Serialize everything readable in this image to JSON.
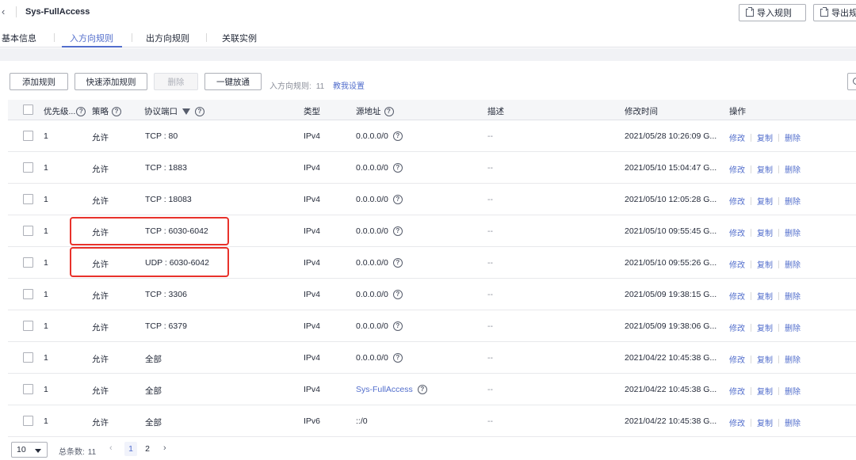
{
  "header": {
    "title": "Sys-FullAccess",
    "import_label": "导入规则",
    "export_label": "导出规"
  },
  "tabs": [
    {
      "label": "基本信息",
      "active": false
    },
    {
      "label": "入方向规则",
      "active": true
    },
    {
      "label": "出方向规则",
      "active": false
    },
    {
      "label": "关联实例",
      "active": false
    }
  ],
  "toolbar": {
    "add_rule": "添加规则",
    "quick_add": "快速添加规则",
    "delete": "删除",
    "one_click": "一键放通",
    "rule_count_label": "入方向规则:",
    "rule_count": "11",
    "help_link": "教我设置"
  },
  "table": {
    "columns": {
      "priority": "优先级...",
      "policy": "策略",
      "protocol_port": "协议端口",
      "type": "类型",
      "source": "源地址",
      "description": "描述",
      "modified": "修改时间",
      "actions": "操作"
    },
    "action_labels": {
      "edit": "修改",
      "copy": "复制",
      "delete": "删除"
    },
    "rows": [
      {
        "priority": "1",
        "policy": "允许",
        "protocol_port": "TCP : 80",
        "type": "IPv4",
        "source": "0.0.0.0/0",
        "source_is_link": false,
        "source_help": true,
        "description": "--",
        "modified": "2021/05/28 10:26:09 G..."
      },
      {
        "priority": "1",
        "policy": "允许",
        "protocol_port": "TCP : 1883",
        "type": "IPv4",
        "source": "0.0.0.0/0",
        "source_is_link": false,
        "source_help": true,
        "description": "--",
        "modified": "2021/05/10 15:04:47 G..."
      },
      {
        "priority": "1",
        "policy": "允许",
        "protocol_port": "TCP : 18083",
        "type": "IPv4",
        "source": "0.0.0.0/0",
        "source_is_link": false,
        "source_help": true,
        "description": "--",
        "modified": "2021/05/10 12:05:28 G..."
      },
      {
        "priority": "1",
        "policy": "允许",
        "protocol_port": "TCP : 6030-6042",
        "type": "IPv4",
        "source": "0.0.0.0/0",
        "source_is_link": false,
        "source_help": true,
        "description": "--",
        "modified": "2021/05/10 09:55:45 G..."
      },
      {
        "priority": "1",
        "policy": "允许",
        "protocol_port": "UDP : 6030-6042",
        "type": "IPv4",
        "source": "0.0.0.0/0",
        "source_is_link": false,
        "source_help": true,
        "description": "--",
        "modified": "2021/05/10 09:55:26 G..."
      },
      {
        "priority": "1",
        "policy": "允许",
        "protocol_port": "TCP : 3306",
        "type": "IPv4",
        "source": "0.0.0.0/0",
        "source_is_link": false,
        "source_help": true,
        "description": "--",
        "modified": "2021/05/09 19:38:15 G..."
      },
      {
        "priority": "1",
        "policy": "允许",
        "protocol_port": "TCP : 6379",
        "type": "IPv4",
        "source": "0.0.0.0/0",
        "source_is_link": false,
        "source_help": true,
        "description": "--",
        "modified": "2021/05/09 19:38:06 G..."
      },
      {
        "priority": "1",
        "policy": "允许",
        "protocol_port": "全部",
        "type": "IPv4",
        "source": "0.0.0.0/0",
        "source_is_link": false,
        "source_help": true,
        "description": "--",
        "modified": "2021/04/22 10:45:38 G..."
      },
      {
        "priority": "1",
        "policy": "允许",
        "protocol_port": "全部",
        "type": "IPv4",
        "source": "Sys-FullAccess",
        "source_is_link": true,
        "source_help": true,
        "description": "--",
        "modified": "2021/04/22 10:45:38 G..."
      },
      {
        "priority": "1",
        "policy": "允许",
        "protocol_port": "全部",
        "type": "IPv6",
        "source": "::/0",
        "source_is_link": false,
        "source_help": false,
        "description": "--",
        "modified": "2021/04/22 10:45:38 G..."
      }
    ]
  },
  "pagination": {
    "page_size": "10",
    "total_label": "总条数:",
    "total": "11",
    "pages": [
      "1",
      "2"
    ],
    "current": "1"
  },
  "colors": {
    "accent": "#526ecc",
    "highlight": "#e8322b"
  }
}
